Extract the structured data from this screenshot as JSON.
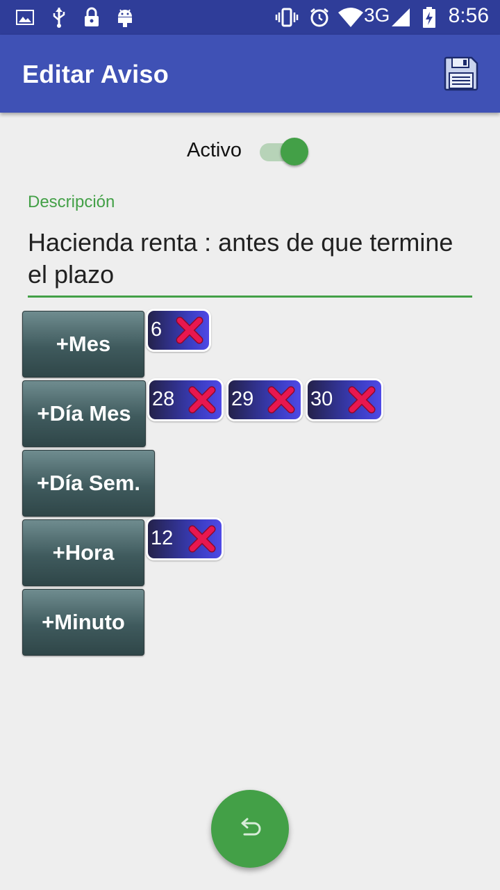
{
  "status_bar": {
    "time": "8:56",
    "network": "3G",
    "icons": [
      "image-icon",
      "usb-icon",
      "lock-icon",
      "android-icon",
      "vibrate-icon",
      "alarm-icon",
      "wifi-icon",
      "signal-icon",
      "battery-icon"
    ]
  },
  "app_bar": {
    "title": "Editar Aviso",
    "save_icon": "floppy-disk-icon"
  },
  "active": {
    "label": "Activo",
    "enabled": true
  },
  "description": {
    "label": "Descripción",
    "value": "Hacienda renta : antes de que termine el plazo"
  },
  "rows": [
    {
      "button": "+Mes",
      "chips": [
        "6"
      ]
    },
    {
      "button": "+Día Mes",
      "chips": [
        "28",
        "29",
        "30"
      ]
    },
    {
      "button": "+Día Sem.",
      "chips": []
    },
    {
      "button": "+Hora",
      "chips": [
        "12"
      ]
    },
    {
      "button": "+Minuto",
      "chips": []
    }
  ],
  "fab": {
    "icon": "undo-icon"
  },
  "colors": {
    "primary": "#3f51b5",
    "primary_dark": "#2f3d99",
    "accent": "#43a047",
    "remove": "#e8174f"
  }
}
